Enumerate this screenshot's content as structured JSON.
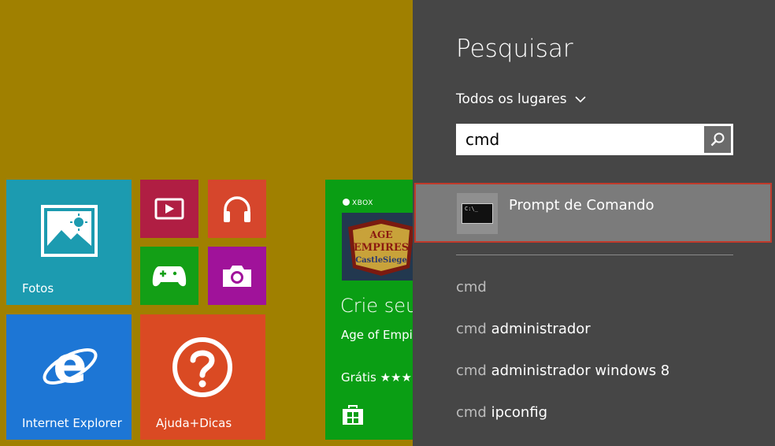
{
  "start": {
    "tiles": {
      "fotos": "Fotos",
      "ie": "Internet Explorer",
      "help": "Ajuda+Dicas"
    },
    "store": {
      "brand": "XBOX",
      "headline": "Crie seu",
      "subtitle": "Age of Empir",
      "price": "Grátis ★★★",
      "game_title_lines": [
        "AGE",
        "EMPIRES",
        "CastleSiege"
      ]
    }
  },
  "search": {
    "title": "Pesquisar",
    "scope": "Todos os lugares",
    "query": "cmd",
    "top_result": {
      "label": "Prompt de Comando",
      "icon_text": "C:\\_"
    },
    "suggestions": [
      {
        "query": "cmd",
        "rest": ""
      },
      {
        "query": "cmd",
        "rest": " administrador"
      },
      {
        "query": "cmd",
        "rest": " administrador windows 8"
      },
      {
        "query": "cmd",
        "rest": " ipconfig"
      }
    ]
  },
  "colors": {
    "desktop_bg": "#a08000",
    "panel_bg": "#464646",
    "selected_result_bg": "#7b7b7b",
    "selected_border": "#c03a2b"
  }
}
